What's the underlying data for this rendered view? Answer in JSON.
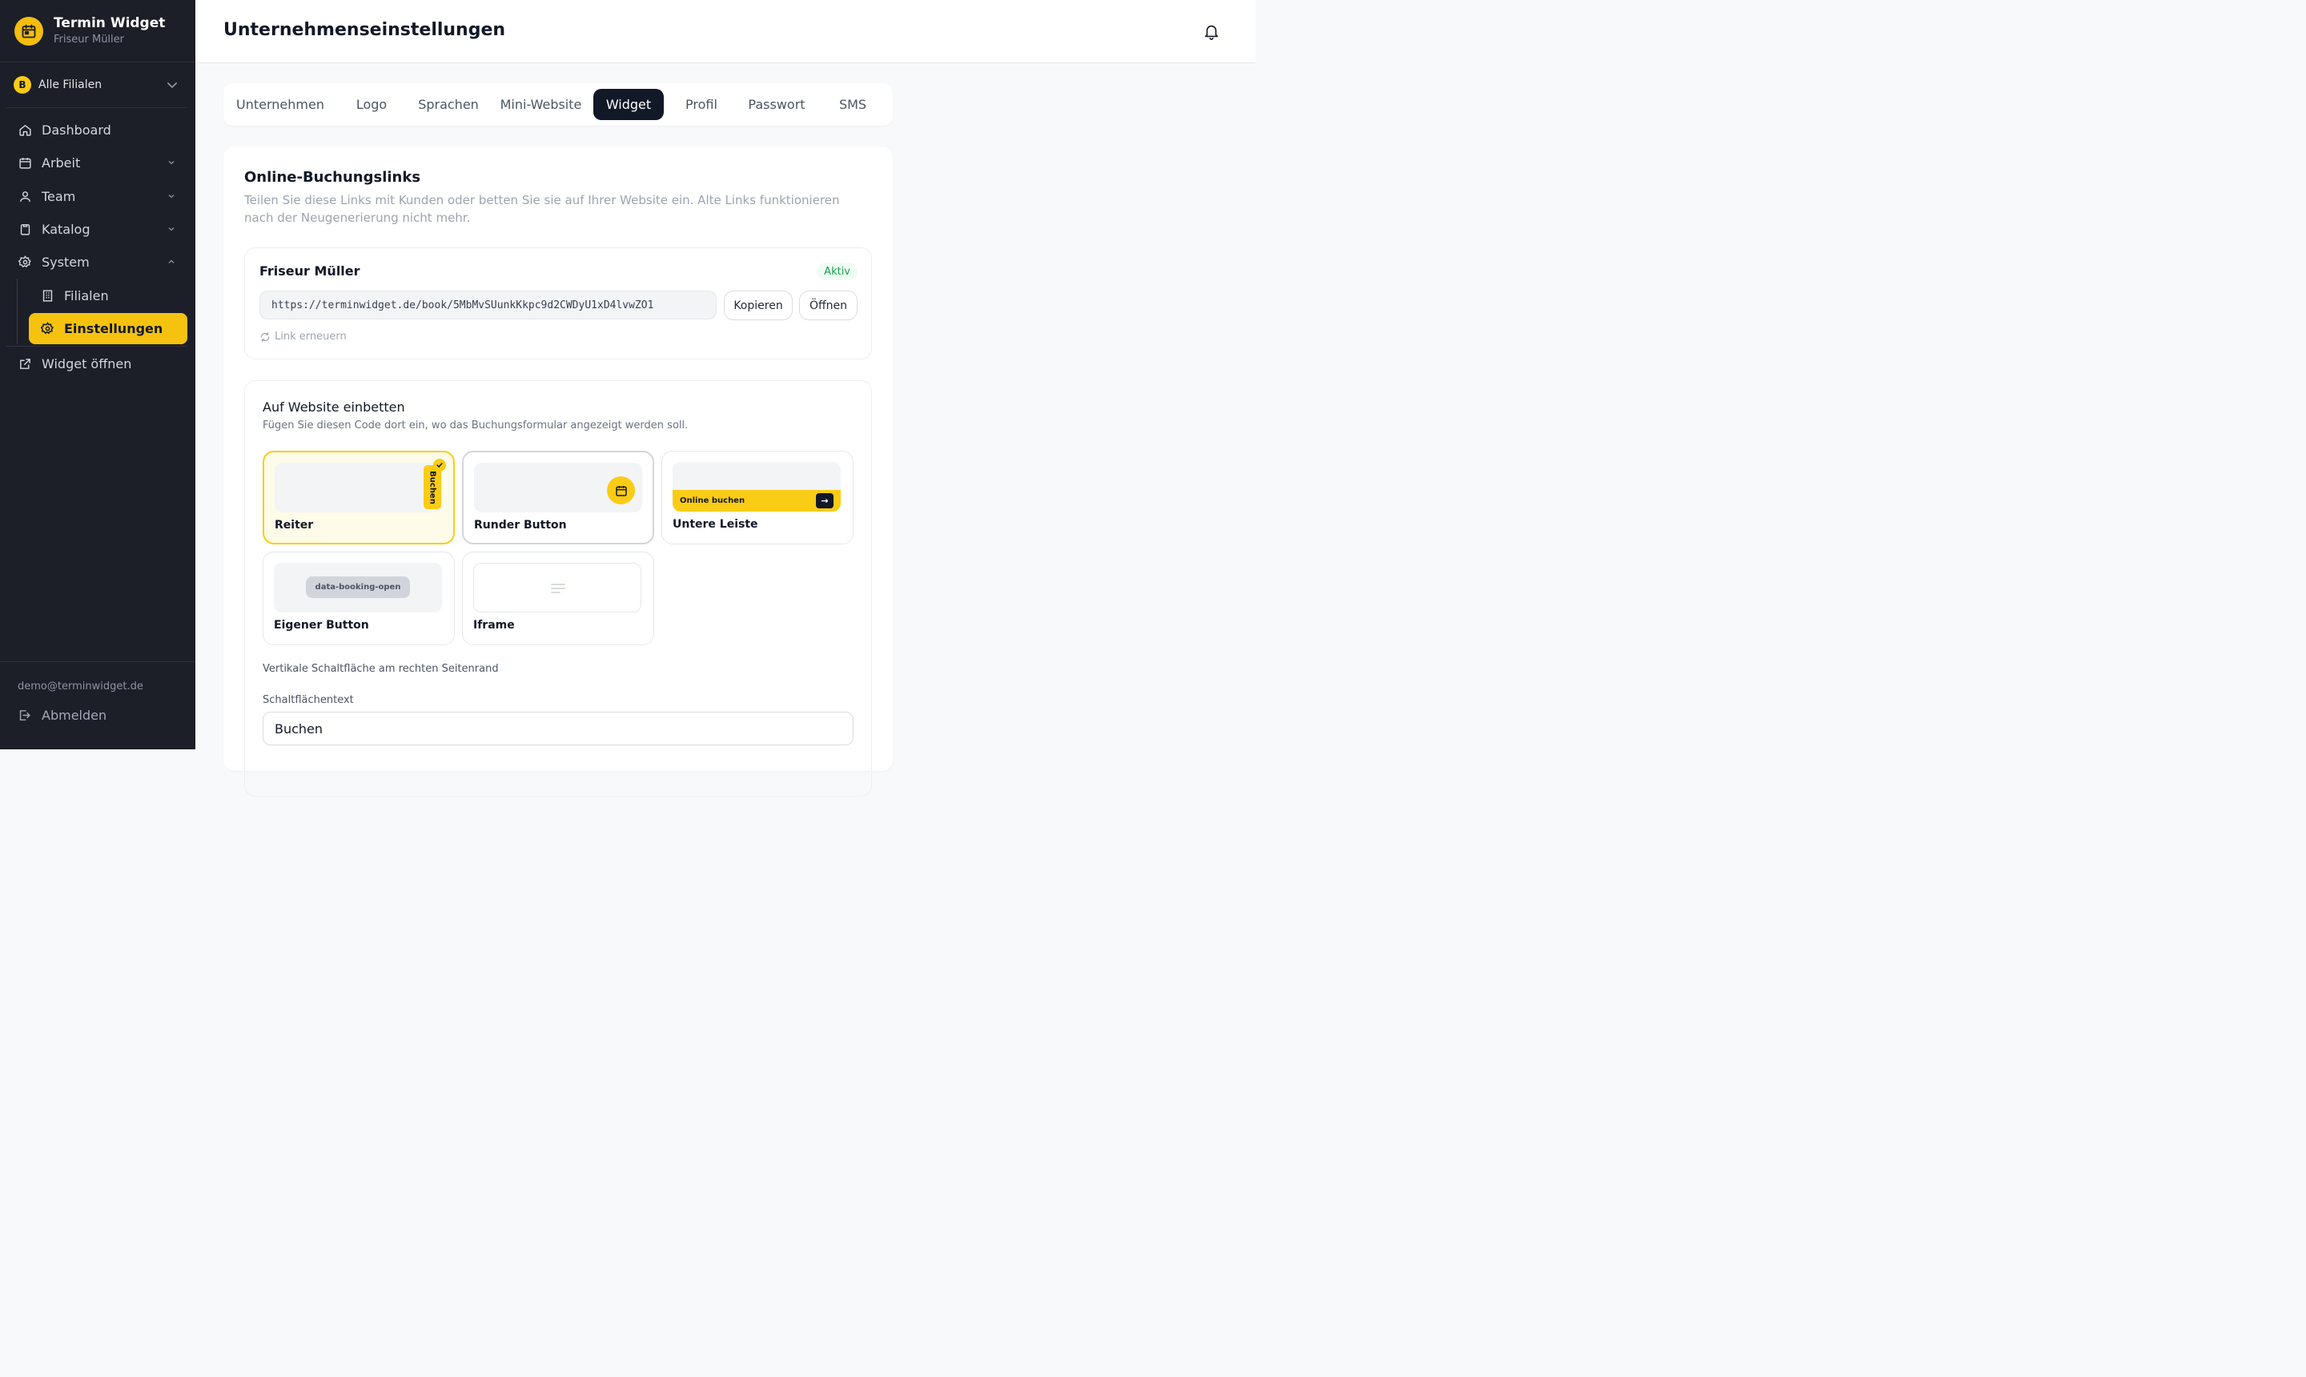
{
  "brand": {
    "title": "Termin Widget",
    "subtitle": "Friseur Müller"
  },
  "branch_selector": {
    "badge": "B",
    "label": "Alle Filialen"
  },
  "nav": {
    "dashboard": "Dashboard",
    "arbeit": "Arbeit",
    "team": "Team",
    "katalog": "Katalog",
    "system": "System",
    "filialen": "Filialen",
    "einstellungen": "Einstellungen",
    "widget_open": "Widget öffnen"
  },
  "user": {
    "email": "demo@terminwidget.de",
    "logout": "Abmelden"
  },
  "header": {
    "title": "Unternehmenseinstellungen"
  },
  "tabs": [
    {
      "label": "Unternehmen"
    },
    {
      "label": "Logo"
    },
    {
      "label": "Sprachen"
    },
    {
      "label": "Mini-Website"
    },
    {
      "label": "Widget"
    },
    {
      "label": "Profil"
    },
    {
      "label": "Passwort"
    },
    {
      "label": "SMS"
    }
  ],
  "active_tab": "Widget",
  "booking_links": {
    "title": "Online-Buchungslinks",
    "description": "Teilen Sie diese Links mit Kunden oder betten Sie sie auf Ihrer Website ein. Alte Links funktionieren nach der Neugenerierung nicht mehr.",
    "link": {
      "name": "Friseur Müller",
      "status": "Aktiv",
      "url": "https://terminwidget.de/book/5MbMvSUunkKkpc9d2CWDyU1xD4lvwZO1",
      "copy_label": "Kopieren",
      "open_label": "Öffnen",
      "renew_label": "Link erneuern"
    }
  },
  "embed": {
    "title": "Auf Website einbetten",
    "description": "Fügen Sie diesen Code dort ein, wo das Buchungsformular angezeigt werden soll.",
    "options": [
      {
        "label": "Reiter",
        "preview_text": "Buchen",
        "selected": true
      },
      {
        "label": "Runder Button",
        "selected": false
      },
      {
        "label": "Untere Leiste",
        "preview_text": "Online buchen",
        "selected": false
      },
      {
        "label": "Eigener Button",
        "preview_text": "data-booking-open",
        "selected": false
      },
      {
        "label": "Iframe",
        "selected": false
      }
    ],
    "option_hint": "Vertikale Schaltfläche am rechten Seitenrand",
    "button_text_label": "Schaltflächentext",
    "button_text_value": "Buchen"
  },
  "colors": {
    "accent": "#facc15",
    "sidebar_bg": "#1c1e28",
    "dark": "#111827",
    "success": "#16a34a"
  }
}
